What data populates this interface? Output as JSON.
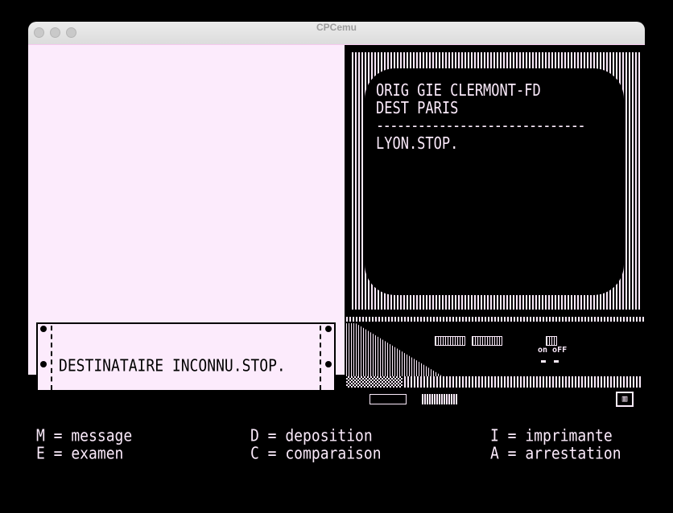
{
  "window": {
    "title": "CPCemu"
  },
  "paper": {
    "text": "DESTINATAIRE INCONNU.STOP."
  },
  "monitor": {
    "lines": [
      "ORIG GIE CLERMONT-FD",
      "DEST PARIS",
      "------------------------------",
      "LYON.STOP."
    ],
    "power_label": "on oFF"
  },
  "menu": {
    "left": [
      "M = message",
      "E = examen"
    ],
    "middle": [
      "D = deposition",
      "C = comparaison"
    ],
    "right": [
      "I = imprimante",
      "A = arrestation"
    ]
  },
  "colors": {
    "foreground": "#fcebfc",
    "background": "#000000"
  }
}
